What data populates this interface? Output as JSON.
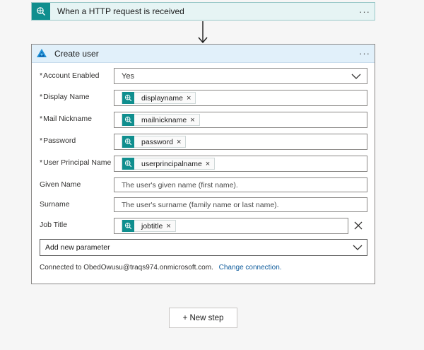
{
  "trigger": {
    "title": "When a HTTP request is received",
    "icon": "http-request-icon",
    "menu": "···"
  },
  "action": {
    "title": "Create user",
    "icon": "azure-ad-icon",
    "menu": "···",
    "fields": [
      {
        "label": "Account Enabled",
        "required": true,
        "type": "select",
        "value": "Yes"
      },
      {
        "label": "Display Name",
        "required": true,
        "type": "token",
        "token": "displayname"
      },
      {
        "label": "Mail Nickname",
        "required": true,
        "type": "token",
        "token": "mailnickname"
      },
      {
        "label": "Password",
        "required": true,
        "type": "token",
        "token": "password"
      },
      {
        "label": "User Principal Name",
        "required": true,
        "type": "token",
        "token": "userprincipalname"
      },
      {
        "label": "Given Name",
        "required": false,
        "type": "text",
        "placeholder": "The user's given name (first name)."
      },
      {
        "label": "Surname",
        "required": false,
        "type": "text",
        "placeholder": "The user's surname (family name or last name)."
      },
      {
        "label": "Job Title",
        "required": false,
        "type": "token",
        "token": "jobtitle"
      }
    ],
    "required_marker": "*",
    "token_remove": "×",
    "add_parameter": "Add new parameter",
    "connected_text": "Connected to ObedOwusu@traqs974.onmicrosoft.com.",
    "change_connection": "Change connection."
  },
  "new_step": "+ New step",
  "colors": {
    "teal": "#0f8e8e",
    "header_blue": "#e1f0fa",
    "link": "#0f5c9c"
  }
}
